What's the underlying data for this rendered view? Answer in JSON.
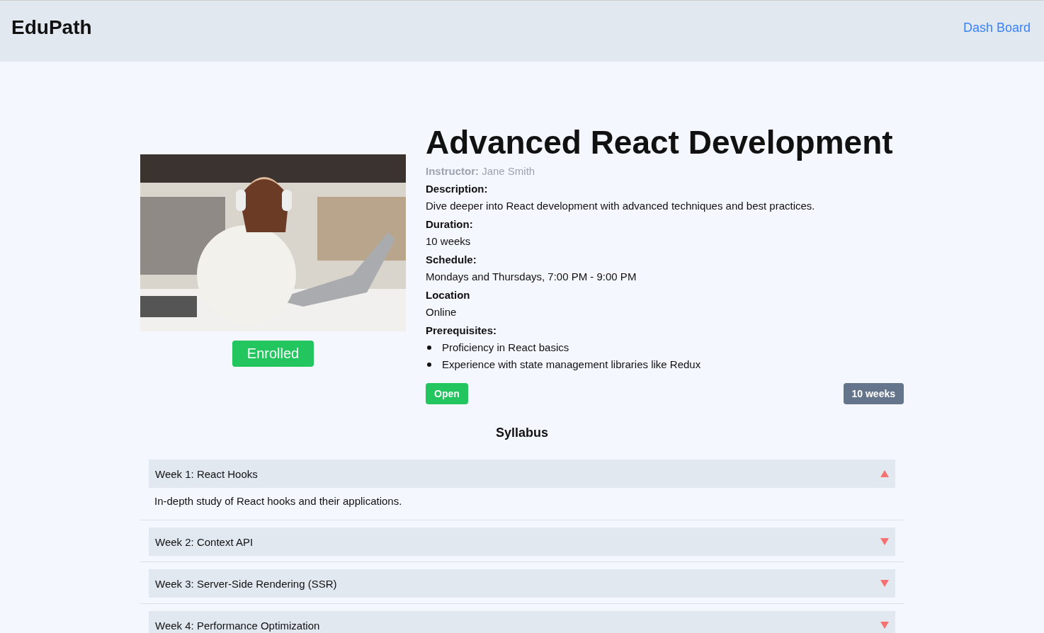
{
  "header": {
    "logo": "EduPath",
    "nav_link": "Dash Board"
  },
  "course": {
    "title": "Advanced React Development",
    "instructor_label": "Instructor:",
    "instructor": "Jane Smith",
    "enroll_button": "Enrolled",
    "details": [
      {
        "label": "Description:",
        "value": "Dive deeper into React development with advanced techniques and best practices."
      },
      {
        "label": "Duration:",
        "value": "10 weeks"
      },
      {
        "label": "Schedule:",
        "value": "Mondays and Thursdays, 7:00 PM - 9:00 PM"
      },
      {
        "label": "Location",
        "value": "Online"
      }
    ],
    "prerequisites_label": "Prerequisites:",
    "prerequisites": [
      "Proficiency in React basics",
      "Experience with state management libraries like Redux"
    ],
    "status_badge": "Open",
    "duration_badge": "10 weeks"
  },
  "syllabus": {
    "title": "Syllabus",
    "weeks": [
      {
        "title": "Week 1: React Hooks",
        "expanded": true,
        "content": "In-depth study of React hooks and their applications."
      },
      {
        "title": "Week 2: Context API",
        "expanded": false
      },
      {
        "title": "Week 3: Server-Side Rendering (SSR)",
        "expanded": false
      },
      {
        "title": "Week 4: Performance Optimization",
        "expanded": false
      }
    ]
  }
}
